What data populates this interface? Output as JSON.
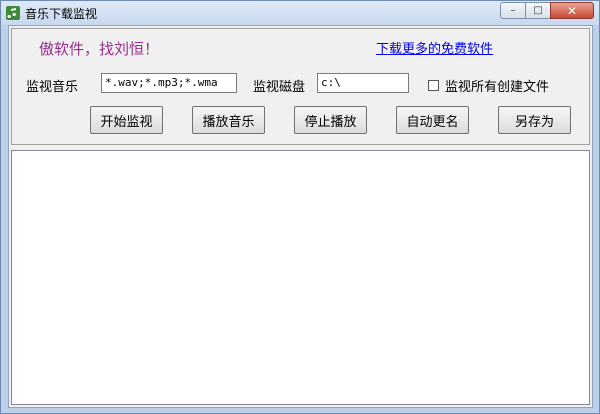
{
  "window": {
    "title": "音乐下载监视",
    "minimize": "–",
    "maximize": "□",
    "close": "✕"
  },
  "header": {
    "slogan": "傲软件，找刘恒！",
    "link": "下载更多的免费软件"
  },
  "form": {
    "music_label": "监视音乐",
    "music_value": "*.wav;*.mp3;*.wma",
    "disk_label": "监视磁盘",
    "disk_value": "c:\\",
    "monitor_all_label": "监视所有创建文件"
  },
  "buttons": {
    "start": "开始监视",
    "play": "播放音乐",
    "stop": "停止播放",
    "rename": "自动更名",
    "save_as": "另存为"
  },
  "colors": {
    "slogan": "#9a2e8e",
    "link": "#0000ee"
  }
}
